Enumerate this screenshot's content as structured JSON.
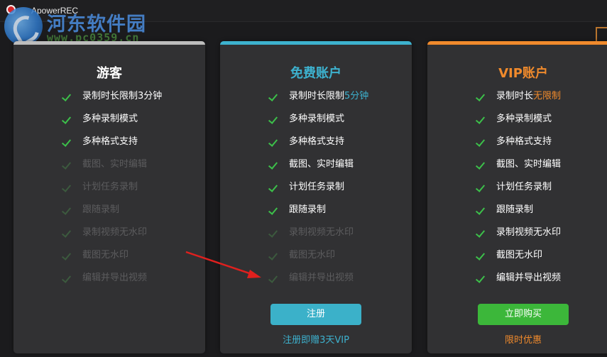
{
  "window": {
    "title": "ApowerREC"
  },
  "watermark": {
    "site_name": "河东软件园",
    "url": "www.pc0359.cn"
  },
  "colors": {
    "guest_bar": "#bdbdbd",
    "free_accent": "#3db2cf",
    "vip_accent": "#f08a2c",
    "register_button": "#3bb1c9",
    "buy_button": "#3cb73a",
    "check_on": "#3cc04a"
  },
  "plans": [
    {
      "title": "游客",
      "features": [
        {
          "text": "录制时长限制3分钟",
          "enabled": true
        },
        {
          "text": "多种录制模式",
          "enabled": true
        },
        {
          "text": "多种格式支持",
          "enabled": true
        },
        {
          "text": "截图、实时编辑",
          "enabled": false
        },
        {
          "text": "计划任务录制",
          "enabled": false
        },
        {
          "text": "跟随录制",
          "enabled": false
        },
        {
          "text": "录制视频无水印",
          "enabled": false
        },
        {
          "text": "截图无水印",
          "enabled": false
        },
        {
          "text": "编辑并导出视频",
          "enabled": false
        }
      ]
    },
    {
      "title": "免费账户",
      "features": [
        {
          "text": "录制时长限制",
          "highlight": "5分钟",
          "enabled": true
        },
        {
          "text": "多种录制模式",
          "enabled": true
        },
        {
          "text": "多种格式支持",
          "enabled": true
        },
        {
          "text": "截图、实时编辑",
          "enabled": true
        },
        {
          "text": "计划任务录制",
          "enabled": true
        },
        {
          "text": "跟随录制",
          "enabled": true
        },
        {
          "text": "录制视频无水印",
          "enabled": false
        },
        {
          "text": "截图无水印",
          "enabled": false
        },
        {
          "text": "编辑并导出视频",
          "enabled": false
        }
      ],
      "button_label": "注册",
      "sub_link": "注册即赠3天VIP"
    },
    {
      "title": "VIP账户",
      "features": [
        {
          "text": "录制时长",
          "highlight": "无限制",
          "enabled": true
        },
        {
          "text": "多种录制模式",
          "enabled": true
        },
        {
          "text": "多种格式支持",
          "enabled": true
        },
        {
          "text": "截图、实时编辑",
          "enabled": true
        },
        {
          "text": "计划任务录制",
          "enabled": true
        },
        {
          "text": "跟随录制",
          "enabled": true
        },
        {
          "text": "录制视频无水印",
          "enabled": true
        },
        {
          "text": "截图无水印",
          "enabled": true
        },
        {
          "text": "编辑并导出视频",
          "enabled": true
        }
      ],
      "button_label": "立即购买",
      "sub_link": "限时优惠"
    }
  ]
}
